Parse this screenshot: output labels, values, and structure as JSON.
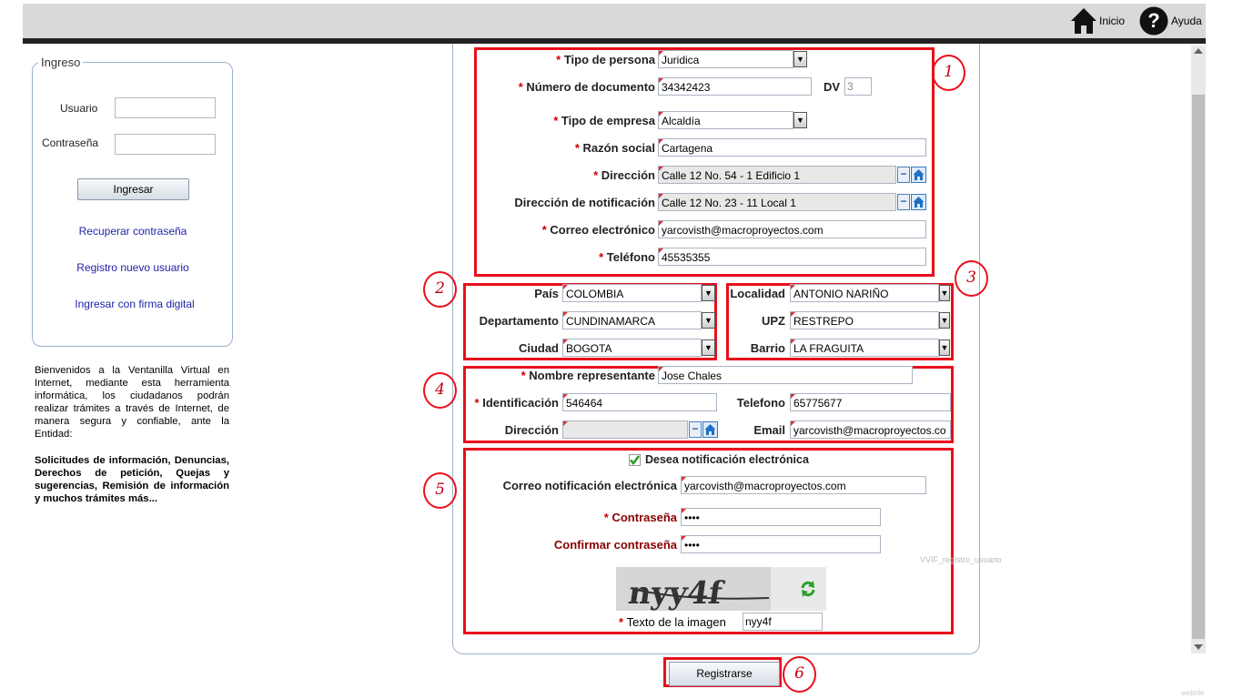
{
  "header": {
    "inicio_label": "Inicio",
    "ayuda_label": "Ayuda"
  },
  "login": {
    "legend": "Ingreso",
    "usuario_label": "Usuario",
    "contrasena_label": "Contraseña",
    "usuario_value": "",
    "contrasena_value": "",
    "ingresar_button": "Ingresar",
    "recuperar_link": "Recuperar contraseña",
    "registro_link": "Registro nuevo usuario",
    "firma_link": "Ingresar con firma digital"
  },
  "welcome": {
    "text": "Bienvenidos a la Ventanilla Virtual en Internet, mediante esta herramienta informática, los ciudadanos podrán realizar trámites a través de Internet, de manera segura y confiable, ante la Entidad:",
    "bold_text": "Solicitudes de información, Denuncias, Derechos de petición, Quejas y sugerencias, Remisión de información y muchos trámites más..."
  },
  "section1": {
    "tipo_persona_label": "Tipo de persona",
    "tipo_persona_value": "Juridica",
    "numero_documento_label": "Número de documento",
    "numero_documento_value": "34342423",
    "dv_label": "DV",
    "dv_value": "3",
    "tipo_empresa_label": "Tipo de empresa",
    "tipo_empresa_value": "Alcaldía",
    "razon_social_label": "Razón social",
    "razon_social_value": "Cartagena",
    "direccion_label": "Dirección",
    "direccion_value": "Calle 12 No. 54 - 1 Edificio 1",
    "direccion_notif_label": "Dirección de notificación",
    "direccion_notif_value": "Calle 12 No. 23 - 11 Local 1",
    "correo_label": "Correo electrónico",
    "correo_value": "yarcovisth@macroproyectos.com",
    "telefono_label": "Teléfono",
    "telefono_value": "45535355"
  },
  "section2": {
    "pais_label": "País",
    "pais_value": "COLOMBIA",
    "departamento_label": "Departamento",
    "departamento_value": "CUNDINAMARCA",
    "ciudad_label": "Ciudad",
    "ciudad_value": "BOGOTA"
  },
  "section3": {
    "localidad_label": "Localidad",
    "localidad_value": "ANTONIO NARIÑO",
    "upz_label": "UPZ",
    "upz_value": "RESTREPO",
    "barrio_label": "Barrio",
    "barrio_value": "LA FRAGUITA"
  },
  "section4": {
    "nombre_rep_label": "Nombre representante",
    "nombre_rep_value": "Jose Chales",
    "identificacion_label": "Identificación",
    "identificacion_value": "546464",
    "telefono_label": "Telefono",
    "telefono_value": "65775677",
    "direccion_label": "Dirección",
    "direccion_value": "",
    "email_label": "Email",
    "email_value": "yarcovisth@macroproyectos.co"
  },
  "section5": {
    "desea_notif_label": "Desea notificación electrónica",
    "desea_notif_checked": true,
    "correo_notif_label": "Correo notificación electrónica",
    "correo_notif_value": "yarcovisth@macroproyectos.com",
    "contrasena_label": "Contraseña",
    "contrasena_value": "••••",
    "confirmar_label": "Confirmar contraseña",
    "confirmar_value": "••••",
    "form_id_text": "VVIF_registro_usuario",
    "captcha_text": "nyy4f",
    "texto_imagen_label": "Texto de la imagen",
    "texto_imagen_value": "nyy4f"
  },
  "registrarse_button": "Registrarse",
  "annotations": [
    "1",
    "2",
    "3",
    "4",
    "5",
    "6"
  ],
  "footer_text": "webrile",
  "colors": {
    "annotation_red": "#e8101c",
    "link_blue": "#1f1fa8",
    "required_red": "#cc0000"
  }
}
